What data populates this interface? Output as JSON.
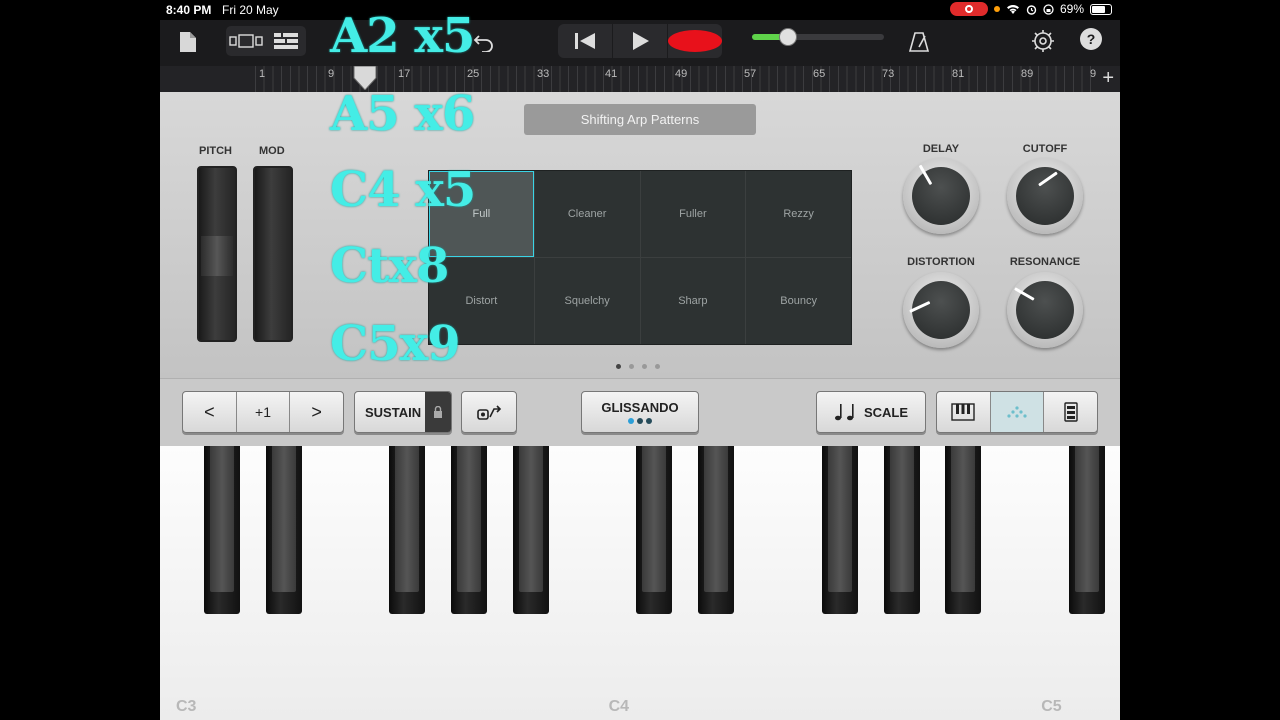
{
  "status_bar": {
    "time": "8:40 PM",
    "date": "Fri 20 May",
    "battery": "69%"
  },
  "toolbar": {
    "icons": [
      "document-icon",
      "view-switch-icon",
      "tracks-icon",
      "undo-icon",
      "rewind-icon",
      "play-icon",
      "record-icon",
      "metronome-icon",
      "settings-icon",
      "help-icon"
    ],
    "help_label": "?",
    "master_volume": 0.27
  },
  "ruler": {
    "bars": [
      "1",
      "9",
      "17",
      "25",
      "33",
      "41",
      "49",
      "57",
      "65",
      "73",
      "81",
      "89",
      "9"
    ],
    "plus": "+"
  },
  "synth": {
    "patch_name": "Shifting Arp Patterns",
    "pitch_label": "PITCH",
    "mod_label": "MOD",
    "pads": [
      "Full",
      "Cleaner",
      "Fuller",
      "Rezzy",
      "Distort",
      "Squelchy",
      "Sharp",
      "Bouncy"
    ],
    "active_pad": "Full",
    "page_count": 4,
    "active_page": 1,
    "knobs": {
      "delay": {
        "label": "DELAY",
        "angle": -30
      },
      "cutoff": {
        "label": "CUTOFF",
        "angle": 55
      },
      "distortion": {
        "label": "DISTORTION",
        "angle": -115
      },
      "resonance": {
        "label": "RESONANCE",
        "angle": -60
      }
    }
  },
  "overlay_notes": [
    "A2 x5",
    "A5 x6",
    "C4 x5",
    "Ctx8",
    "C5x9"
  ],
  "controls": {
    "octave_down": "<",
    "octave_value": "+1",
    "octave_up": ">",
    "sustain": "SUSTAIN",
    "glissando": "GLISSANDO",
    "scale": "SCALE",
    "colors": {
      "accent": "#3ad4e6",
      "record": "#e8111b",
      "volume": "#5fd34a",
      "overlay": "#44ede6"
    }
  },
  "keyboard": {
    "labels": [
      "C3",
      "C4",
      "C5"
    ]
  }
}
